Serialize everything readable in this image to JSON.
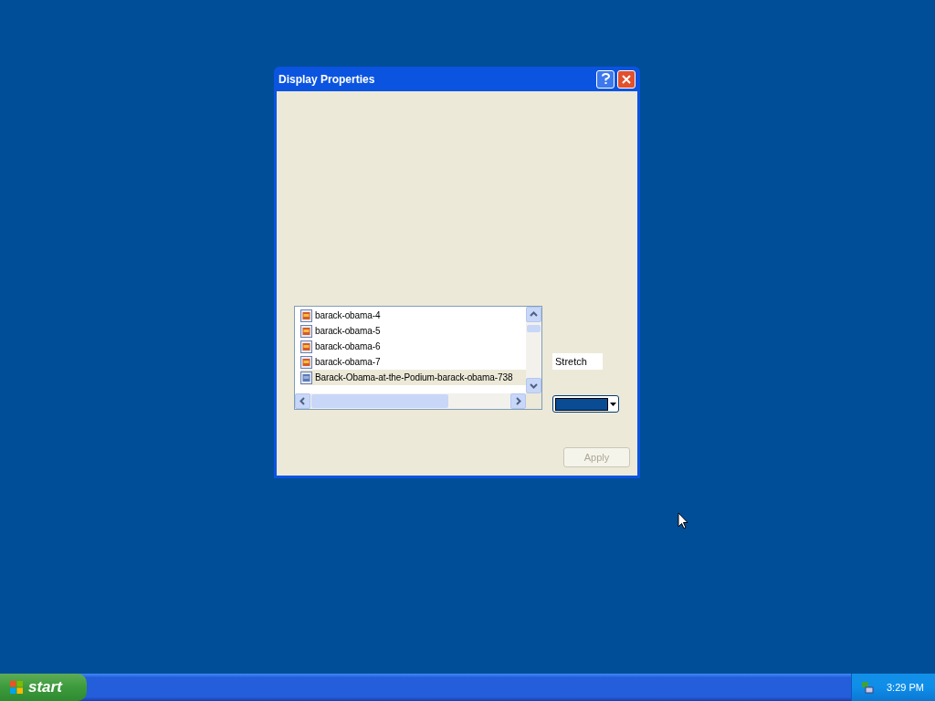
{
  "window": {
    "title": "Display Properties"
  },
  "file_list": {
    "items": [
      {
        "label": "barack-obama-4",
        "selected": false
      },
      {
        "label": "barack-obama-5",
        "selected": false
      },
      {
        "label": "barack-obama-6",
        "selected": false
      },
      {
        "label": "barack-obama-7",
        "selected": false
      },
      {
        "label": "Barack-Obama-at-the-Podium-barack-obama-738",
        "selected": true
      }
    ]
  },
  "position_field": {
    "value": "Stretch"
  },
  "color_picker": {
    "color": "#0a4c94"
  },
  "apply_button": {
    "label": "Apply",
    "disabled": true
  },
  "taskbar": {
    "start_label": "start",
    "clock": "3:29 PM"
  }
}
